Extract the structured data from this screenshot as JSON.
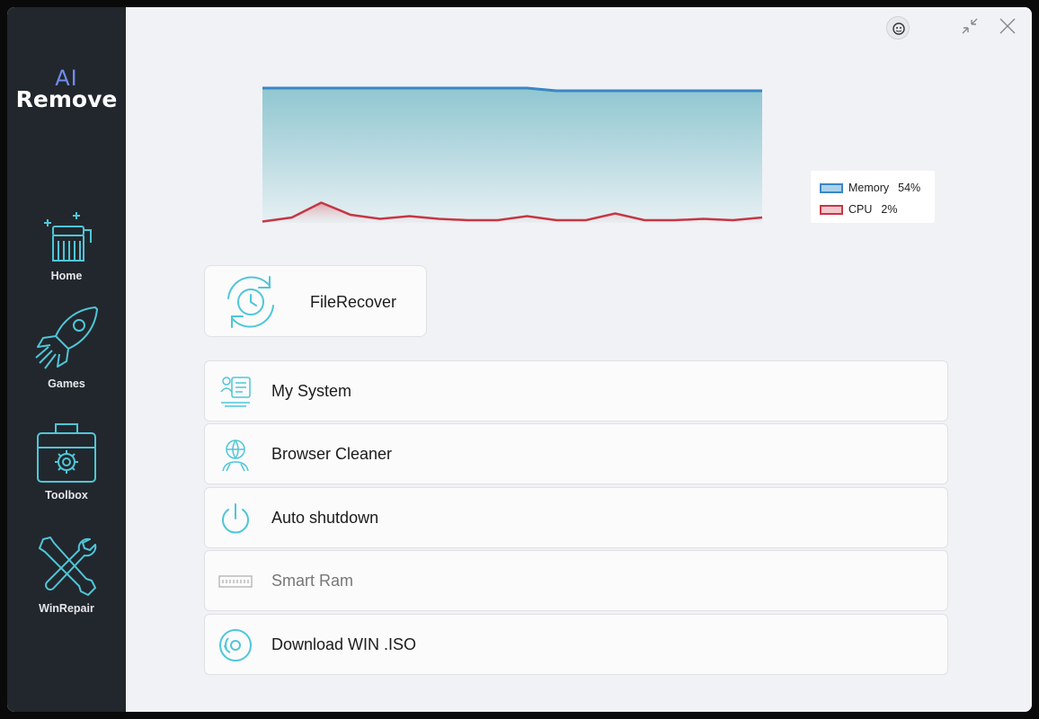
{
  "app": {
    "logo_line1": "AI",
    "logo_line2": "Remove"
  },
  "sidebar": {
    "items": [
      {
        "label": "Home",
        "icon": "broom-sparkle-icon"
      },
      {
        "label": "Games",
        "icon": "rocket-icon"
      },
      {
        "label": "Toolbox",
        "icon": "toolbox-gear-icon"
      },
      {
        "label": "WinRepair",
        "icon": "wrench-screwdriver-icon"
      }
    ]
  },
  "titlebar": {
    "icons": [
      "avatar-icon",
      "minimize-shrink-icon",
      "close-icon"
    ]
  },
  "chart_data": {
    "type": "area",
    "title": "",
    "series": [
      {
        "name": "Memory",
        "color": "#3a87c4",
        "values": [
          55,
          55,
          55,
          55,
          55,
          55,
          55,
          55,
          55,
          55,
          54,
          54,
          54,
          54,
          54,
          54,
          54,
          54
        ]
      },
      {
        "name": "CPU",
        "color": "#c53744",
        "values": [
          1,
          4,
          15,
          6,
          3,
          5,
          3,
          2,
          2,
          5,
          2,
          2,
          7,
          2,
          2,
          3,
          2,
          4
        ]
      }
    ],
    "ylim": [
      0,
      100
    ],
    "grid": false,
    "legend_position": "right"
  },
  "legend": {
    "memory_label": "Memory",
    "memory_value": "54%",
    "cpu_label": "CPU",
    "cpu_value": "2%"
  },
  "tools": {
    "file_recover": {
      "label": "FileRecover",
      "icon": "clock-recover-icon"
    },
    "items": [
      {
        "label": "My System",
        "icon": "system-info-icon",
        "enabled": true
      },
      {
        "label": "Browser Cleaner",
        "icon": "browser-globe-icon",
        "enabled": true
      },
      {
        "label": "Auto shutdown",
        "icon": "power-icon",
        "enabled": true
      },
      {
        "label": "Smart Ram",
        "icon": "ram-module-icon",
        "enabled": false
      },
      {
        "label": "Download WIN .ISO",
        "icon": "disc-icon",
        "enabled": true
      }
    ]
  },
  "colors": {
    "sidebar_bg": "#22272d",
    "accent_teal": "#4fc6d8",
    "logo_blue": "#6f8df0",
    "content_bg": "#f1f2f6"
  }
}
